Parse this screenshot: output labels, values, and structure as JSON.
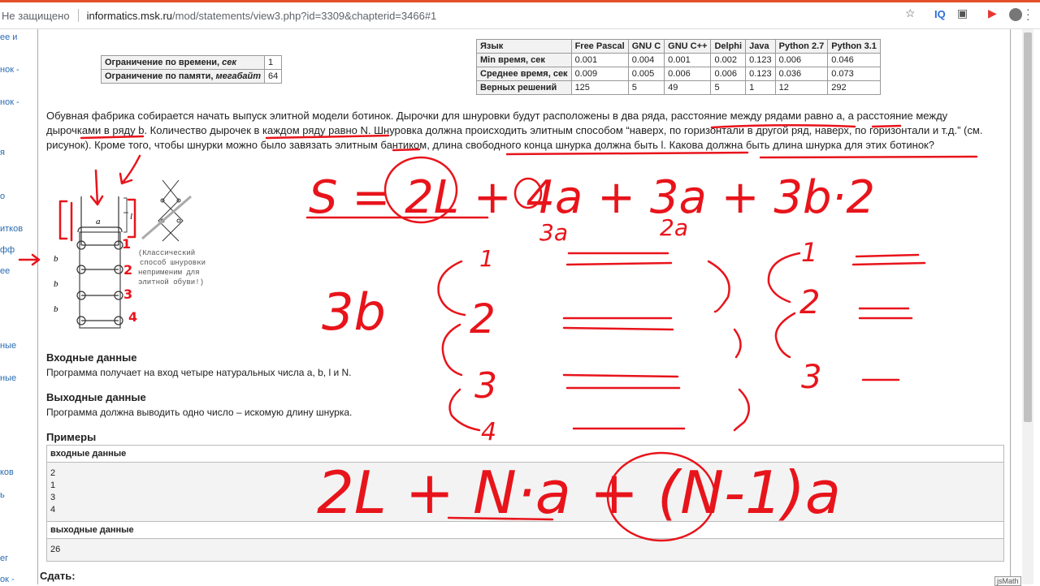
{
  "browser": {
    "security_text": "Не защищено",
    "url_host": "informatics.msk.ru",
    "url_path": "/mod/statements/view3.php?id=3309&chapterid=3466#1",
    "iq_label": "IQ",
    "star_icon": "star-icon",
    "extension_icon": "extension-icon",
    "youtube_icon": "youtube-icon",
    "menu_icon": "kebab-menu-icon"
  },
  "sidebar": {
    "items": [
      "ее и",
      "нок -",
      "нок -",
      "я",
      "о",
      "итков",
      "фф",
      "ее",
      "ные",
      "ные",
      "ков",
      "ь",
      "eг",
      "ок -"
    ]
  },
  "limits": {
    "time_label": "Ограничение по времени, ",
    "time_unit": "сек",
    "time_value": "1",
    "memory_label": "Ограничение по памяти, ",
    "memory_unit": "мегабайт",
    "memory_value": "64"
  },
  "langs": {
    "header": [
      "Язык",
      "Free Pascal",
      "GNU C",
      "GNU C++",
      "Delphi",
      "Java",
      "Python 2.7",
      "Python 3.1"
    ],
    "rows": [
      [
        "Min время, сек",
        "0.001",
        "0.004",
        "0.001",
        "0.002",
        "0.123",
        "0.006",
        "0.046"
      ],
      [
        "Среднее время, сек",
        "0.009",
        "0.005",
        "0.006",
        "0.006",
        "0.123",
        "0.036",
        "0.073"
      ],
      [
        "Верных решений",
        "125",
        "5",
        "49",
        "5",
        "1",
        "12",
        "292"
      ]
    ]
  },
  "statement": {
    "text": "Обувная фабрика собирается начать выпуск элитной модели ботинок. Дырочки для шнуровки будут расположены в два ряда, расстояние между рядами равно a, а расстояние между дырочками в ряду b. Количество дырочек в каждом ряду равно N. Шнуровка должна происходить элитным способом “наверх, по горизонтали в другой ряд, наверх, по горизонтали и т.д.” (см. рисунок). Кроме того, чтобы шнурки можно было завязать элитным бантиком, длина свободного конца шнурка должна быть l. Какова должна быть длина шнурка для этих ботинок?"
  },
  "figure": {
    "caption": [
      "(Классический",
      "способ шнуровки",
      "неприменим для",
      "элитной обуви!)"
    ],
    "label_a": "a",
    "label_l": "l",
    "label_b": "b"
  },
  "input_section": {
    "title": "Входные данные",
    "text": "Программа получает на вход четыре натуральных числа a, b, l и N."
  },
  "output_section": {
    "title": "Выходные данные",
    "text": "Программа должна выводить одно число – искомую длину шнурка."
  },
  "examples": {
    "title": "Примеры",
    "input_label": "входные данные",
    "input_lines": [
      "2",
      "1",
      "3",
      "4"
    ],
    "output_label": "выходные данные",
    "output_value": "26"
  },
  "submit_label": "Сдать:",
  "jsmath_label": "jsMath",
  "annotations": {
    "formula_top_1": "S = 2L + 4a + 3a + 3b·2",
    "sub_3a": "3a",
    "sub_2a": "2a",
    "left_note": "3b",
    "num_1": "1",
    "num_2": "2",
    "num_3": "3",
    "num_4": "4",
    "right_1": "1",
    "right_2": "2",
    "right_3": "3",
    "bottom_formula": "2L + N·a + (N-1)a",
    "ink_color": "#e8141b"
  }
}
